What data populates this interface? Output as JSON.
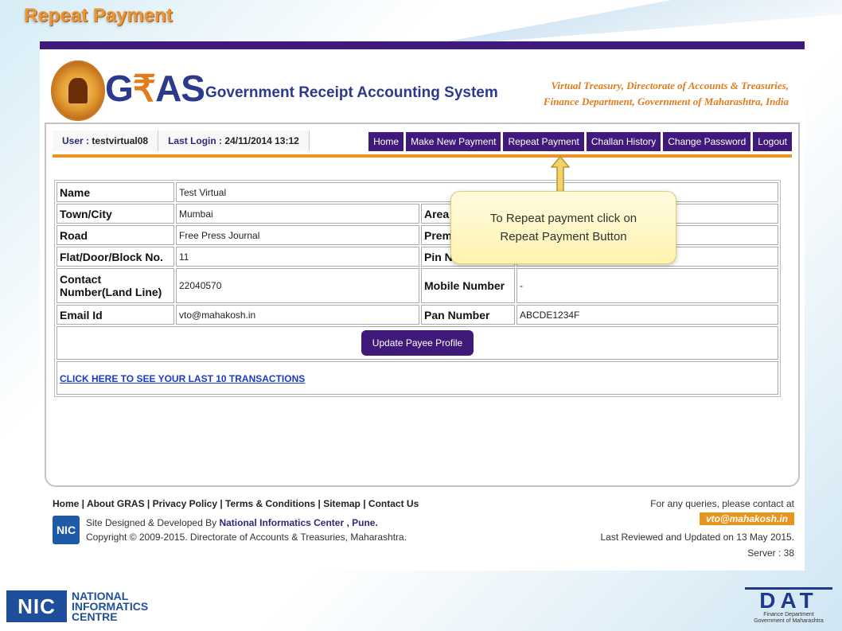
{
  "slide_title": "Repeat Payment",
  "banner": {
    "logo_g": "G",
    "logo_r": "₹",
    "logo_as": "AS",
    "system_name": "Government Receipt Accounting System",
    "dept_line1": "Virtual Treasury, Directorate of Accounts & Treasuries,",
    "dept_line2": "Finance Department, Government of Maharashtra, India"
  },
  "user_bar": {
    "user_label": "User : ",
    "user_value": "testvirtual08",
    "login_label": "Last Login : ",
    "login_value": "24/11/2014 13:12"
  },
  "nav": {
    "home": "Home",
    "make_new_payment": "Make New Payment",
    "repeat_payment": "Repeat Payment",
    "challan_history": "Challan History",
    "change_password": "Change Password",
    "logout": "Logout"
  },
  "profile": {
    "name_label": "Name",
    "name_value": "Test Virtual",
    "town_label": "Town/City",
    "town_value": "Mumbai",
    "area_label": "Area",
    "road_label": "Road",
    "road_value": "Free Press Journal",
    "premises_label": "Prem",
    "flat_label": "Flat/Door/Block No.",
    "flat_value": "11",
    "pin_label": "Pin N",
    "contact_label": "Contact Number(Land Line)",
    "contact_value": "22040570",
    "mobile_label": "Mobile Number",
    "mobile_value": "-",
    "email_label": "Email Id",
    "email_value": "vto@mahakosh.in",
    "pan_label": "Pan Number",
    "pan_value": "ABCDE1234F",
    "update_button": "Update Payee Profile",
    "transactions_link": "CLICK HERE TO SEE YOUR LAST 10 TRANSACTIONS"
  },
  "callout": {
    "line1": "To Repeat payment click on",
    "line2": "Repeat Payment Button"
  },
  "footer": {
    "links": [
      "Home",
      "About GRAS",
      "Privacy Policy",
      "Terms & Conditions",
      "Sitemap",
      "Contact Us"
    ],
    "separator": " | ",
    "nic_mini": "NIC",
    "designed_prefix": "Site Designed & Developed By ",
    "designed_org": "National Informatics Center , Pune.",
    "copyright": "Copyright © 2009-2015. Directorate of Accounts & Treasuries, Maharashtra.",
    "query_text": "For any queries, please contact at",
    "query_email": "vto@mahakosh.in",
    "reviewed": "Last Reviewed and Updated on 13 May 2015.",
    "server": "Server : 38"
  },
  "nic_logo": {
    "mark": "NIC",
    "line1": "NATIONAL",
    "line2": "INFORMATICS",
    "line3": "CENTRE"
  },
  "dat_logo": {
    "mark": "DAT",
    "line1": "Finance Department",
    "line2": "Government of Maharashtra"
  },
  "colors": {
    "brand_purple": "#3f1a7a",
    "accent_orange": "#e8951f",
    "link_blue": "#1a3cc4"
  }
}
